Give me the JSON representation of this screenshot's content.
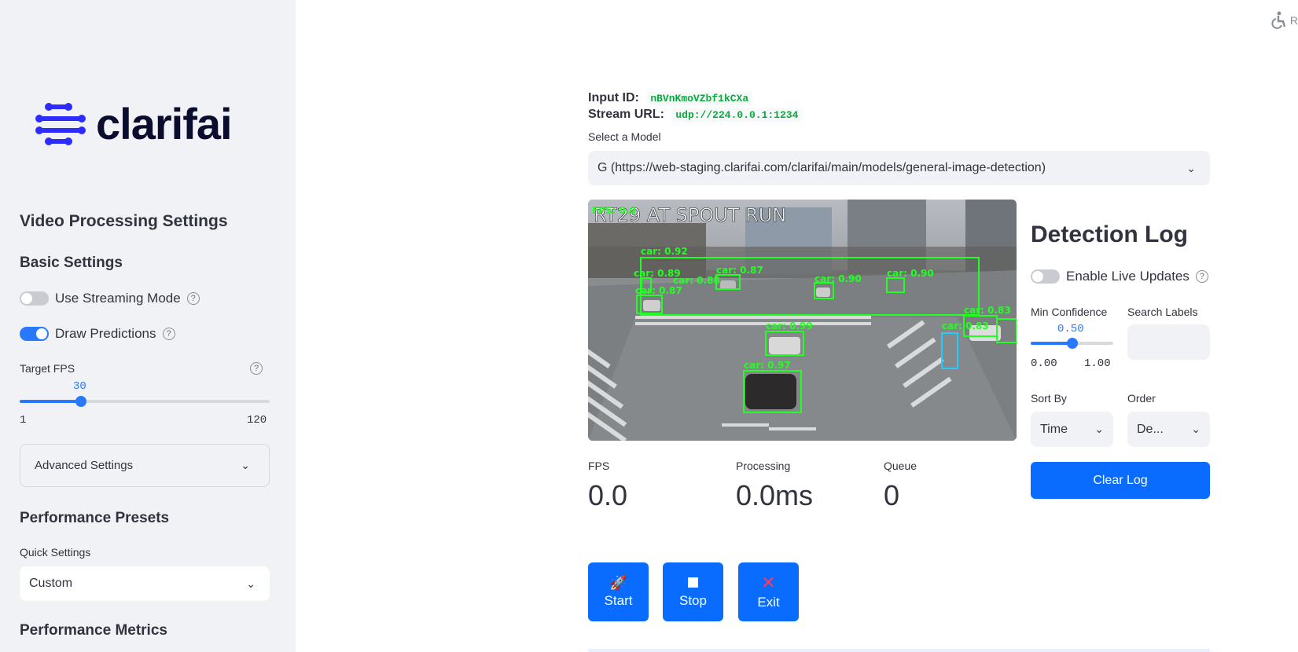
{
  "sidebar": {
    "logo_text": "clarifai",
    "section_title": "Video Processing Settings",
    "basic_settings": "Basic Settings",
    "streaming_mode_label": "Use Streaming Mode",
    "draw_predictions_label": "Draw Predictions",
    "target_fps_label": "Target FPS",
    "target_fps_value": "30",
    "target_fps_min": "1",
    "target_fps_max": "120",
    "target_fps_fraction": 0.244,
    "advanced_settings": "Advanced Settings",
    "performance_presets": "Performance Presets",
    "quick_settings_label": "Quick Settings",
    "quick_settings_value": "Custom",
    "performance_metrics": "Performance Metrics",
    "streaming_mode_on": false,
    "draw_predictions_on": true
  },
  "header": {
    "a11y_text": "R"
  },
  "main": {
    "input_id_label": "Input ID:",
    "input_id_value": "nBVnKmoVZbf1kCXa",
    "stream_url_label": "Stream URL:",
    "stream_url_value": "udp://224.0.0.1:1234",
    "select_model_label": "Select a Model",
    "model_value": "G (https://web-staging.clarifai.com/clarifai/main/models/general-image-detection)",
    "video": {
      "overlay_title": "RT29 AT SPOUT RUN",
      "fps_overlay": "FPS: 0.0",
      "detections": [
        "car: 0.92",
        "car: 0.89",
        "car: 0.88",
        "car: 0.87",
        "car: 0.90",
        "car: 0.90",
        "car: 0.87",
        "car: 0.99",
        "car: 0.97",
        "car: 0.83",
        "car: 0.83"
      ]
    },
    "metrics": {
      "fps_label": "FPS",
      "fps_value": "0.0",
      "processing_label": "Processing",
      "processing_value": "0.0ms",
      "queue_label": "Queue",
      "queue_value": "0"
    },
    "buttons": {
      "start": "Start",
      "stop": "Stop",
      "exit": "Exit"
    }
  },
  "detection_log": {
    "title": "Detection Log",
    "live_updates_label": "Enable Live Updates",
    "live_updates_on": false,
    "min_confidence_label": "Min Confidence",
    "min_confidence_value": "0.50",
    "min_confidence_min": "0.00",
    "min_confidence_max": "1.00",
    "min_confidence_fraction": 0.5,
    "search_labels_label": "Search Labels",
    "search_labels_value": "",
    "sort_by_label": "Sort By",
    "sort_by_value": "Time",
    "order_label": "Order",
    "order_value": "De...",
    "clear_log": "Clear Log"
  },
  "colors": {
    "accent": "#2979ff",
    "button": "#0a6cff",
    "detection_box": "#22ff22",
    "sidebar_bg": "#f0f2f6",
    "logo_blue": "#2c2cff",
    "logo_dark": "#0b0d2e"
  },
  "icons": {
    "start": "rocket-icon",
    "stop": "stop-square-icon",
    "exit": "cross-mark-icon",
    "accessibility": "accessibility-icon",
    "help": "help-circle-icon",
    "chevron": "chevron-down-icon"
  }
}
